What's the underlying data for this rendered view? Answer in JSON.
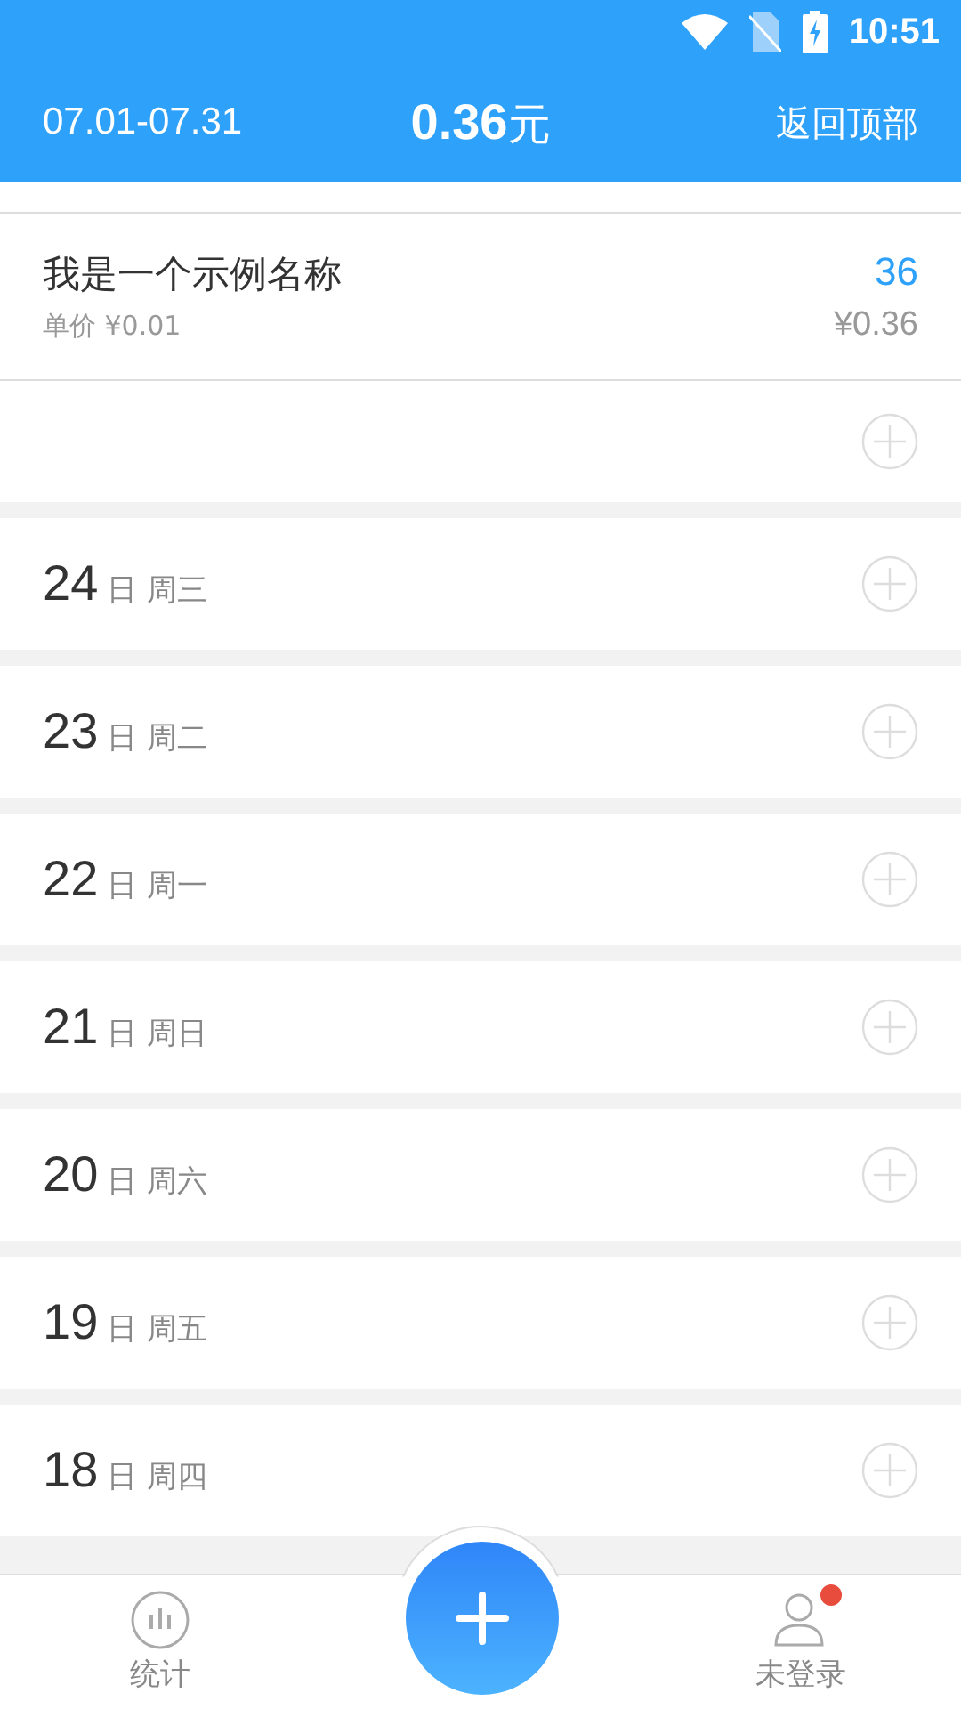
{
  "status_bar": {
    "time": "10:51"
  },
  "header": {
    "range": "07.01-07.31",
    "amount": "0.36",
    "unit": "元",
    "back_to_top": "返回顶部"
  },
  "item": {
    "name": "我是一个示例名称",
    "unit_price": "单价 ¥0.01",
    "count": "36",
    "total": "¥0.36"
  },
  "days": [
    {
      "day": "24",
      "weekday": "日 周三"
    },
    {
      "day": "23",
      "weekday": "日 周二"
    },
    {
      "day": "22",
      "weekday": "日 周一"
    },
    {
      "day": "21",
      "weekday": "日 周日"
    },
    {
      "day": "20",
      "weekday": "日 周六"
    },
    {
      "day": "19",
      "weekday": "日 周五"
    },
    {
      "day": "18",
      "weekday": "日 周四"
    }
  ],
  "bottom_nav": [
    {
      "kind": "stats",
      "label": "统计",
      "badge": false
    },
    {
      "kind": "user",
      "label": "未登录",
      "badge": true
    }
  ]
}
